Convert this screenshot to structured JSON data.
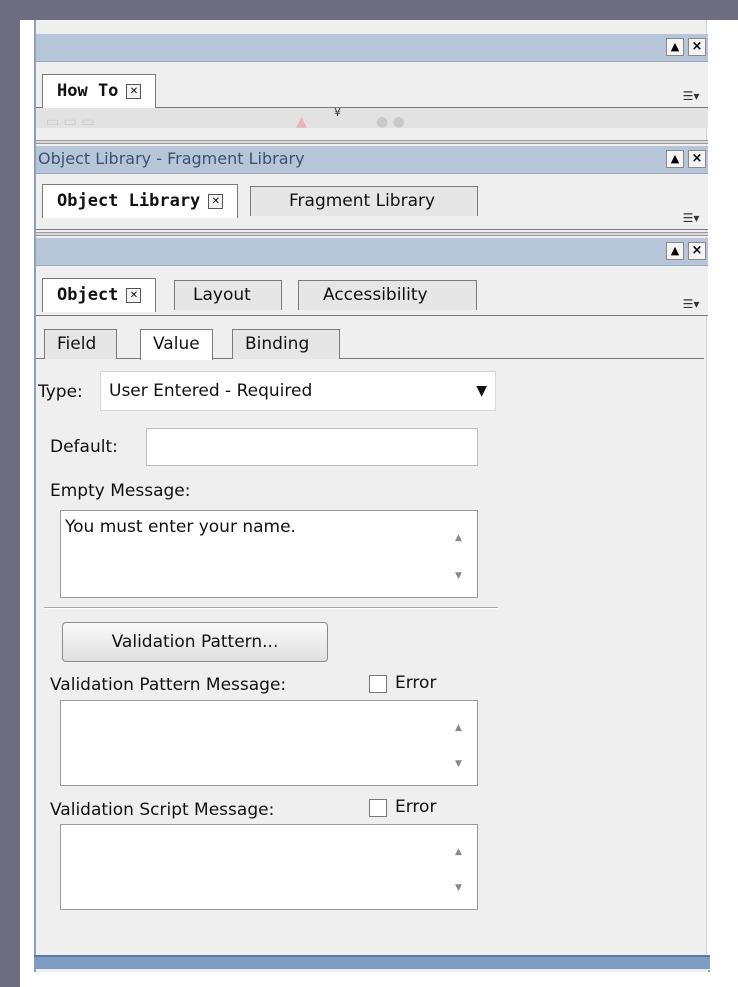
{
  "panels": {
    "how_to": {
      "header_title": "",
      "tabs": [
        {
          "label": "How To",
          "active": true
        }
      ],
      "close_glyph": "×",
      "collapse_glyph": "▲"
    },
    "library": {
      "header_title": "Object Library - Fragment Library",
      "tabs": [
        {
          "label": "Object Library",
          "active": true
        },
        {
          "label": "Fragment Library",
          "active": false
        }
      ]
    },
    "object": {
      "header_title": "",
      "tabs": [
        {
          "label": "Object",
          "active": true
        },
        {
          "label": "Layout",
          "active": false
        },
        {
          "label": "Accessibility",
          "active": false
        }
      ],
      "sub_tabs": [
        {
          "label": "Field",
          "active": false
        },
        {
          "label": "Value",
          "active": true
        },
        {
          "label": "Binding",
          "active": false
        }
      ]
    }
  },
  "form": {
    "type_label": "Type:",
    "type_value": "User Entered - Required",
    "default_label": "Default:",
    "default_value": "",
    "empty_message_label": "Empty Message:",
    "empty_message_value": "You must enter your name.",
    "validation_pattern_button": "Validation Pattern...",
    "validation_pattern_message_label": "Validation Pattern Message:",
    "validation_pattern_error_label": "Error",
    "validation_pattern_error_checked": false,
    "validation_pattern_message_value": "",
    "validation_script_message_label": "Validation Script Message:",
    "validation_script_error_label": "Error",
    "validation_script_error_checked": false,
    "validation_script_message_value": ""
  },
  "icons": {
    "tab_close": "close-small-icon",
    "panel_collapse": "triangle-up-icon",
    "panel_close": "close-icon",
    "panel_menu": "panel-menu-icon",
    "dropdown": "chevron-down-icon",
    "expand": "double-chevron-down-icon"
  },
  "colors": {
    "panel_header": "#b6c6d8",
    "panel_title_text": "#3b5272",
    "frame_border": "#8aa0bc",
    "frame_bottom": "#7f9cc4",
    "background": "#efefef"
  }
}
